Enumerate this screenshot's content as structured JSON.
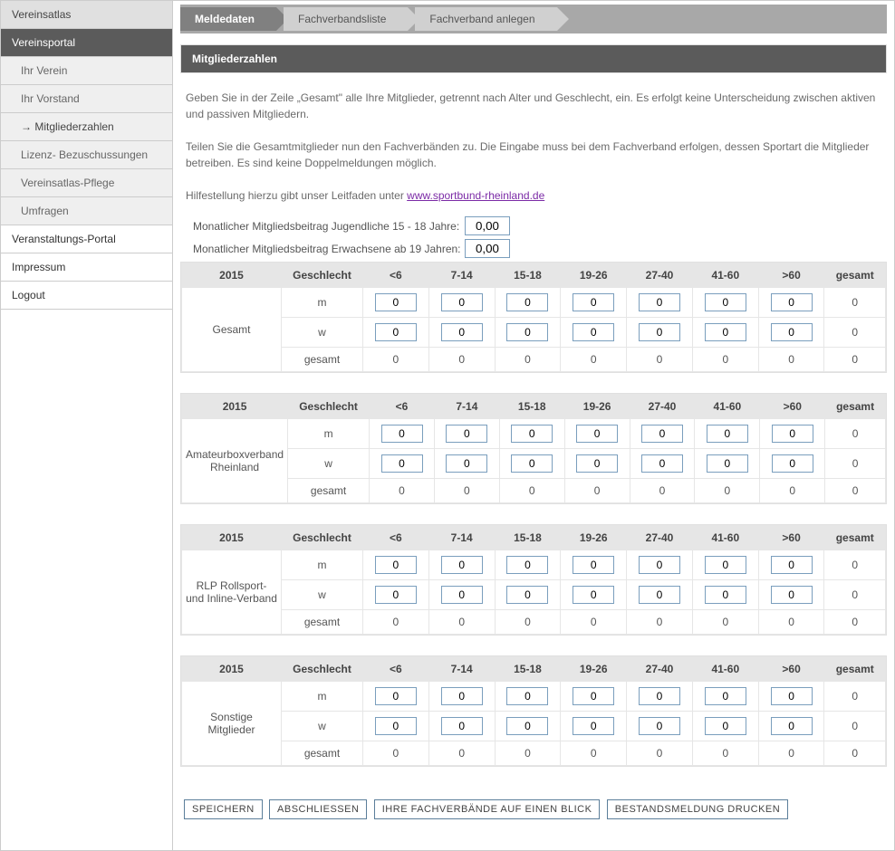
{
  "sidebar": {
    "atlas": "Vereinsatlas",
    "portal": "Vereinsportal",
    "sub": {
      "verein": "Ihr Verein",
      "vorstand": "Ihr Vorstand",
      "mitgliederzahlen": "Mitgliederzahlen",
      "lizenz": "Lizenz- Bezuschussungen",
      "pflege": "Vereinsatlas-Pflege",
      "umfragen": "Umfragen"
    },
    "veranstaltung": "Veranstaltungs-Portal",
    "impressum": "Impressum",
    "logout": "Logout"
  },
  "tabs": {
    "meldedaten": "Meldedaten",
    "fachverbandsliste": "Fachverbandsliste",
    "fachverband_anlegen": "Fachverband anlegen"
  },
  "panel_title": "Mitgliederzahlen",
  "info": {
    "p1": "Geben Sie in der Zeile „Gesamt\" alle Ihre Mitglieder, getrennt nach Alter und Geschlecht, ein. Es erfolgt keine Unterscheidung zwischen aktiven und passiven Mitgliedern.",
    "p2": "Teilen Sie die Gesamtmitglieder nun den Fachverbänden zu. Die Eingabe muss bei dem Fachverband erfolgen, dessen Sportart die Mitglieder betreiben. Es sind keine Doppelmeldungen möglich.",
    "p3a": "Hilfestellung hierzu gibt unser Leitfaden unter ",
    "link": "www.sportbund-rheinland.de"
  },
  "fees": {
    "youth_label": "Monatlicher Mitgliedsbeitrag Jugendliche 15 - 18 Jahre:",
    "youth_value": "0,00",
    "adult_label": "Monatlicher Mitgliedsbeitrag Erwachsene ab 19 Jahren:",
    "adult_value": "0,00"
  },
  "columns": {
    "year": "2015",
    "gender": "Geschlecht",
    "c1": "<6",
    "c2": "7-14",
    "c3": "15-18",
    "c4": "19-26",
    "c5": "27-40",
    "c6": "41-60",
    "c7": ">60",
    "total": "gesamt"
  },
  "gender": {
    "m": "m",
    "w": "w",
    "gesamt": "gesamt"
  },
  "sections": {
    "s1": {
      "name": "Gesamt",
      "m": {
        "c1": "0",
        "c2": "0",
        "c3": "0",
        "c4": "0",
        "c5": "0",
        "c6": "0",
        "c7": "0",
        "tot": "0"
      },
      "w": {
        "c1": "0",
        "c2": "0",
        "c3": "0",
        "c4": "0",
        "c5": "0",
        "c6": "0",
        "c7": "0",
        "tot": "0"
      },
      "g": {
        "c1": "0",
        "c2": "0",
        "c3": "0",
        "c4": "0",
        "c5": "0",
        "c6": "0",
        "c7": "0",
        "tot": "0"
      }
    },
    "s2": {
      "name": "Amateurboxverband Rheinland",
      "m": {
        "c1": "0",
        "c2": "0",
        "c3": "0",
        "c4": "0",
        "c5": "0",
        "c6": "0",
        "c7": "0",
        "tot": "0"
      },
      "w": {
        "c1": "0",
        "c2": "0",
        "c3": "0",
        "c4": "0",
        "c5": "0",
        "c6": "0",
        "c7": "0",
        "tot": "0"
      },
      "g": {
        "c1": "0",
        "c2": "0",
        "c3": "0",
        "c4": "0",
        "c5": "0",
        "c6": "0",
        "c7": "0",
        "tot": "0"
      }
    },
    "s3": {
      "name": "RLP Rollsport- und Inline-Verband",
      "m": {
        "c1": "0",
        "c2": "0",
        "c3": "0",
        "c4": "0",
        "c5": "0",
        "c6": "0",
        "c7": "0",
        "tot": "0"
      },
      "w": {
        "c1": "0",
        "c2": "0",
        "c3": "0",
        "c4": "0",
        "c5": "0",
        "c6": "0",
        "c7": "0",
        "tot": "0"
      },
      "g": {
        "c1": "0",
        "c2": "0",
        "c3": "0",
        "c4": "0",
        "c5": "0",
        "c6": "0",
        "c7": "0",
        "tot": "0"
      }
    },
    "s4": {
      "name": "Sonstige Mitglieder",
      "m": {
        "c1": "0",
        "c2": "0",
        "c3": "0",
        "c4": "0",
        "c5": "0",
        "c6": "0",
        "c7": "0",
        "tot": "0"
      },
      "w": {
        "c1": "0",
        "c2": "0",
        "c3": "0",
        "c4": "0",
        "c5": "0",
        "c6": "0",
        "c7": "0",
        "tot": "0"
      },
      "g": {
        "c1": "0",
        "c2": "0",
        "c3": "0",
        "c4": "0",
        "c5": "0",
        "c6": "0",
        "c7": "0",
        "tot": "0"
      }
    }
  },
  "buttons": {
    "save": "speichern",
    "close": "Abschliessen",
    "overview": "Ihre Fachverbände auf einen Blick",
    "print": "Bestandsmeldung drucken"
  }
}
